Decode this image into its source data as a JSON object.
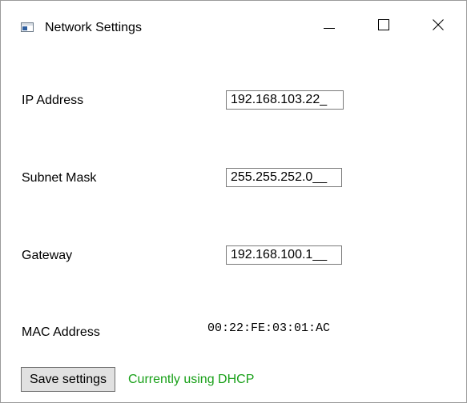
{
  "window": {
    "title": "Network Settings",
    "icon": "window-app-icon",
    "controls": {
      "minimize_icon": "minimize-icon",
      "maximize_icon": "maximize-icon",
      "close_icon": "close-icon"
    }
  },
  "form": {
    "ip": {
      "label": "IP Address",
      "value": "192.168.103.22_"
    },
    "subnet": {
      "label": "Subnet Mask",
      "value": "255.255.252.0__"
    },
    "gateway": {
      "label": "Gateway",
      "value": "192.168.100.1__"
    },
    "mac": {
      "label": "MAC Address",
      "value": "00:22:FE:03:01:AC"
    }
  },
  "footer": {
    "save_label": "Save settings",
    "status_text": "Currently using DHCP",
    "status_color": "#18a018"
  }
}
